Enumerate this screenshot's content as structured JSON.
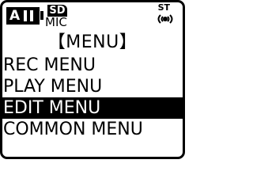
{
  "status": {
    "mode": "A",
    "storage": "SD",
    "input": "MIC",
    "channel": "ST",
    "stereo_icon": "stereo-mic-icon"
  },
  "title": "【MENU】",
  "menu_items": [
    {
      "label": "REC MENU",
      "selected": false
    },
    {
      "label": "PLAY MENU",
      "selected": false
    },
    {
      "label": "EDIT MENU",
      "selected": true
    },
    {
      "label": "COMMON MENU",
      "selected": false
    }
  ],
  "colors": {
    "background": "#ffffff",
    "foreground": "#000000",
    "highlight": "#000000"
  }
}
